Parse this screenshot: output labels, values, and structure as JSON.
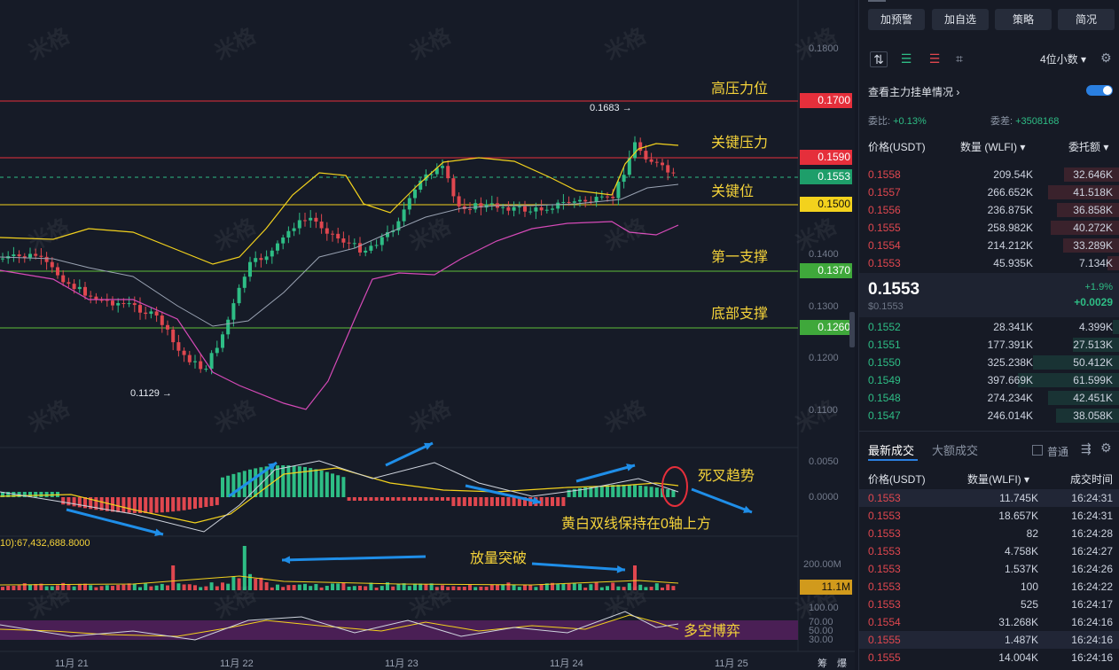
{
  "chart": {
    "y_scale": [
      "0.1800",
      "0.1400",
      "0.1300",
      "0.1200",
      "0.1100"
    ],
    "macd_scale": [
      "0.0050",
      "0.0000"
    ],
    "vol_scale": "200.00M",
    "rsi_scale": [
      "100.00",
      "70.00",
      "50.00",
      "30.00"
    ],
    "price_tags": [
      {
        "label": "0.1700",
        "color": "#e52f3b"
      },
      {
        "label": "0.1590",
        "color": "#e52f3b"
      },
      {
        "label": "0.1553",
        "color": "#1e9e6a"
      },
      {
        "label": "0.1500",
        "color": "#f3d21d"
      },
      {
        "label": "0.1370",
        "color": "#3fa83b"
      },
      {
        "label": "0.1260",
        "color": "#3fa83b"
      }
    ],
    "vol_tag": "11.1M",
    "high_label": "0.1683",
    "low_label": "0.1129",
    "volume_text": "10):67,432,688.8000",
    "dates": [
      "11月 21",
      "11月 22",
      "11月 23",
      "11月 24",
      "11月 25"
    ],
    "bottom_right": [
      "筹",
      "爆"
    ],
    "annotations": {
      "high_resist": "高压力位",
      "key_resist": "关键压力",
      "key_level": "关键位",
      "first_support": "第一支撑",
      "bottom_support": "底部支撑",
      "death_cross": "死叉趋势",
      "above_zero": "黄白双线保持在0轴上方",
      "volume_break": "放量突破",
      "long_short": "多空博弈"
    },
    "watermark": "米格"
  },
  "panel": {
    "buttons": [
      "加预警",
      "加自选",
      "策略",
      "简况"
    ],
    "decimals": "4位小数",
    "order_view": "查看主力挂单情况",
    "ratio_label": "委比:",
    "ratio_value": "+0.13%",
    "diff_label": "委差:",
    "diff_value": "+3508168",
    "col_price": "价格(USDT)",
    "col_qty": "数量 (WLFI)",
    "col_total": "委托额",
    "asks": [
      {
        "p": "0.1558",
        "q": "209.54K",
        "t": "32.646K",
        "w": 0.55
      },
      {
        "p": "0.1557",
        "q": "266.652K",
        "t": "41.518K",
        "w": 0.7
      },
      {
        "p": "0.1556",
        "q": "236.875K",
        "t": "36.858K",
        "w": 0.62
      },
      {
        "p": "0.1555",
        "q": "258.982K",
        "t": "40.272K",
        "w": 0.68
      },
      {
        "p": "0.1554",
        "q": "214.212K",
        "t": "33.289K",
        "w": 0.56
      },
      {
        "p": "0.1553",
        "q": "45.935K",
        "t": "7.134K",
        "w": 0.12
      }
    ],
    "last_price": "0.1553",
    "last_usd": "$0.1553",
    "change_pct": "+1.9%",
    "change_abs": "+0.0029",
    "bids": [
      {
        "p": "0.1552",
        "q": "28.341K",
        "t": "4.399K",
        "w": 0.07
      },
      {
        "p": "0.1551",
        "q": "177.391K",
        "t": "27.513K",
        "w": 0.46
      },
      {
        "p": "0.1550",
        "q": "325.238K",
        "t": "50.412K",
        "w": 0.85
      },
      {
        "p": "0.1549",
        "q": "397.669K",
        "t": "61.599K",
        "w": 1.0
      },
      {
        "p": "0.1548",
        "q": "274.234K",
        "t": "42.451K",
        "w": 0.7
      },
      {
        "p": "0.1547",
        "q": "246.014K",
        "t": "38.058K",
        "w": 0.63
      }
    ],
    "tab_latest": "最新成交",
    "tab_large": "大额成交",
    "normal_label": "普通",
    "trade_col_price": "价格(USDT)",
    "trade_col_qty": "数量(WLFI)",
    "trade_col_time": "成交时间",
    "trades": [
      {
        "p": "0.1553",
        "q": "11.745K",
        "t": "16:24:31",
        "c": "red"
      },
      {
        "p": "0.1553",
        "q": "18.657K",
        "t": "16:24:31",
        "c": "red"
      },
      {
        "p": "0.1553",
        "q": "82",
        "t": "16:24:28",
        "c": "red"
      },
      {
        "p": "0.1553",
        "q": "4.758K",
        "t": "16:24:27",
        "c": "red"
      },
      {
        "p": "0.1553",
        "q": "1.537K",
        "t": "16:24:26",
        "c": "red"
      },
      {
        "p": "0.1553",
        "q": "100",
        "t": "16:24:22",
        "c": "red"
      },
      {
        "p": "0.1553",
        "q": "525",
        "t": "16:24:17",
        "c": "red"
      },
      {
        "p": "0.1554",
        "q": "31.268K",
        "t": "16:24:16",
        "c": "red"
      },
      {
        "p": "0.1555",
        "q": "1.487K",
        "t": "16:24:16",
        "c": "red"
      },
      {
        "p": "0.1555",
        "q": "14.004K",
        "t": "16:24:16",
        "c": "red"
      }
    ]
  }
}
